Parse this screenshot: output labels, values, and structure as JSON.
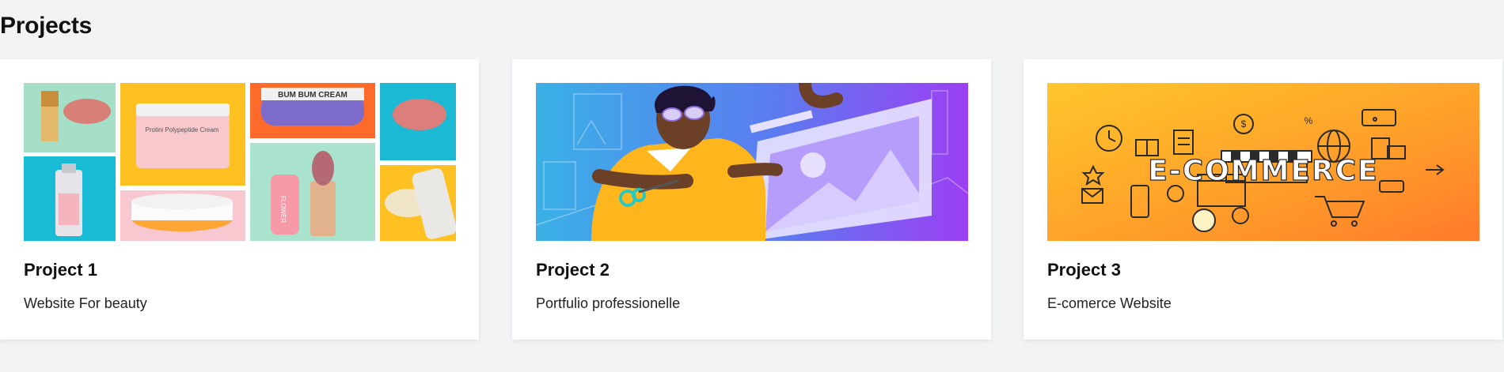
{
  "page": {
    "title": "Projects"
  },
  "projects": [
    {
      "title": "Project 1",
      "description": "Website For beauty",
      "image": "beauty-products-collage",
      "image_text": {
        "jar_label": "Protini Polypeptide Cream",
        "body_butter_label": "BUM BUM CREAM",
        "tube_label": "FLOWER"
      }
    },
    {
      "title": "Project 2",
      "description": "Portfulio professionelle",
      "image": "designer-illustration"
    },
    {
      "title": "Project 3",
      "description": "E-comerce Website",
      "image": "ecommerce-icons-banner",
      "image_text": "E-COMMERCE"
    }
  ],
  "colors": {
    "page_background": "#f2f3f5",
    "card_background": "#ffffff",
    "ecommerce_orange": "#ff8c2a",
    "design_purple": "#8a4bf2"
  }
}
